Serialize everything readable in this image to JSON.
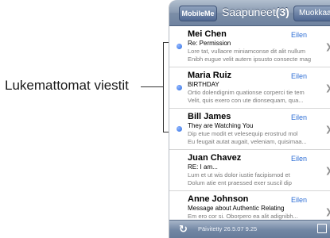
{
  "callout": {
    "label": "Lukemattomat viestit"
  },
  "navbar": {
    "back_label": "MobileMe",
    "title": "Saapuneet",
    "unread_count": "(3)",
    "edit_label": "Muokkaa"
  },
  "messages": [
    {
      "sender": "Mei Chen",
      "date": "Eilen",
      "subject": "Re: Permission",
      "preview_1": "Lore tat, vullaore miniamconse dit alit nullum",
      "preview_2": "Enibh eugue velit autem ipsusto consecte mag",
      "unread": true
    },
    {
      "sender": "Maria Ruiz",
      "date": "Eilen",
      "subject": "BIRTHDAY",
      "preview_1": "Ortio dolendignim quationse corperci tie tem",
      "preview_2": "Velit, quis exero con ute dionsequam, qua...",
      "unread": true
    },
    {
      "sender": "Bill James",
      "date": "Eilen",
      "subject": "They are Watching You",
      "preview_1": "Dip etue modit et velesequip erostrud mol",
      "preview_2": "Eu feugait autat augait, veleniam, quisimaa...",
      "unread": true
    },
    {
      "sender": "Juan Chavez",
      "date": "Eilen",
      "subject": "RE: I am...",
      "preview_1": "Lum et ut wis dolor iustie facipismod et",
      "preview_2": "Dolum atie ent praessed exer suscil dip",
      "unread": false
    },
    {
      "sender": "Anne Johnson",
      "date": "Eilen",
      "subject": "Message about Authentic Relating",
      "preview_1": "Em ero cor si. Oborpero ea alit adignibh...",
      "preview_2": "",
      "unread": false
    }
  ],
  "toolbar": {
    "updated_text": "Päivitetty  26.5.07  9.25",
    "refresh_icon": "refresh-icon",
    "compose_icon": "compose-icon"
  },
  "colors": {
    "unread_dot": "#2f6ee0",
    "date_link": "#2f6fd6",
    "navbar": "#7c8ea7"
  }
}
